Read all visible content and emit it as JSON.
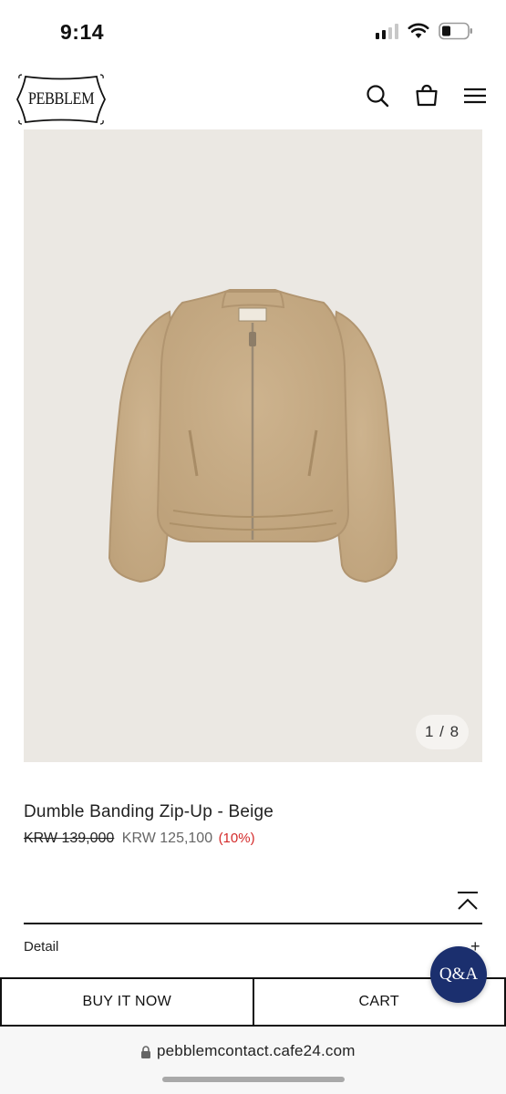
{
  "status_bar": {
    "time": "9:14"
  },
  "header": {
    "logo_text": "PEBBLEM"
  },
  "product": {
    "image_counter": "1 / 8",
    "title": "Dumble Banding Zip-Up - Beige",
    "original_price": "KRW 139,000",
    "sale_price": "KRW 125,100",
    "discount": "(10%)"
  },
  "sections": {
    "detail_label": "Detail",
    "detail_toggle": "+"
  },
  "qa_button": {
    "label": "Q&A"
  },
  "actions": {
    "buy_now_label": "BUY IT NOW",
    "cart_label": "CART"
  },
  "browser": {
    "url": "pebblemcontact.cafe24.com"
  },
  "colors": {
    "accent": "#1b2f6e",
    "discount": "#d42a2a",
    "image_bg": "#ebe8e3",
    "jacket": "#c8ae88"
  },
  "icons": [
    "signal-icon",
    "wifi-icon",
    "battery-icon",
    "search-icon",
    "bag-icon",
    "menu-icon",
    "collapse-up-icon",
    "lock-icon"
  ]
}
